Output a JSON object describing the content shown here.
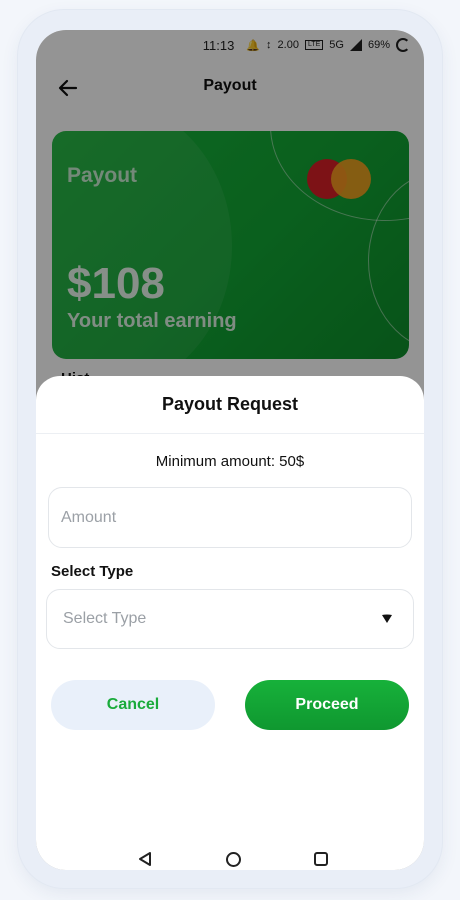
{
  "status_bar": {
    "time": "11:13",
    "speed_top": "2.00",
    "speed_unit": "KB/S",
    "lte_label": "LTE",
    "network_label": "5G",
    "battery": "69%"
  },
  "header": {
    "title": "Payout"
  },
  "card": {
    "title": "Payout",
    "amount": "$108",
    "subtitle": "Your total earning",
    "colors": {
      "brand_green": "#12a534",
      "mc_red": "#d81f26",
      "mc_orange": "#f7a01e"
    }
  },
  "history": {
    "label": "Hist"
  },
  "sheet": {
    "title": "Payout Request",
    "min_amount": "Minimum amount: 50$",
    "amount_placeholder": "Amount",
    "select_label": "Select Type",
    "select_placeholder": "Select Type",
    "cancel_label": "Cancel",
    "proceed_label": "Proceed"
  },
  "icons": {
    "back": "arrow-left-icon",
    "dropdown": "chevron-down-icon",
    "nav": [
      "nav-back-icon",
      "nav-home-icon",
      "nav-recents-icon"
    ]
  }
}
